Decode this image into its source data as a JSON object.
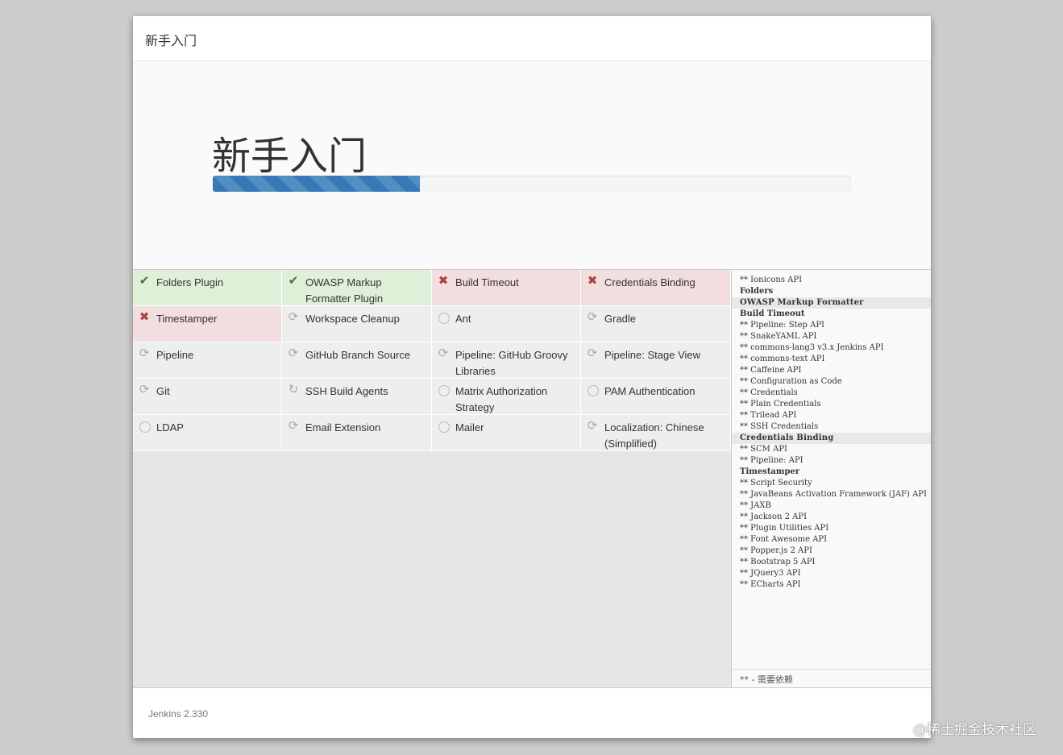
{
  "dialog": {
    "header_title": "新手入门",
    "hero_title": "新手入门",
    "progress_fraction": 0.325
  },
  "plugins": [
    {
      "label": "Folders Plugin",
      "status": "success",
      "icon": "check-icon"
    },
    {
      "label": "OWASP Markup Formatter Plugin",
      "status": "success",
      "icon": "check-icon"
    },
    {
      "label": "Build Timeout",
      "status": "fail",
      "icon": "cross-icon"
    },
    {
      "label": "Credentials Binding",
      "status": "fail",
      "icon": "cross-icon"
    },
    {
      "label": "Timestamper",
      "status": "fail",
      "icon": "cross-icon"
    },
    {
      "label": "Workspace Cleanup",
      "status": "pending",
      "icon": "refresh-icon"
    },
    {
      "label": "Ant",
      "status": "pending",
      "icon": "circle-icon"
    },
    {
      "label": "Gradle",
      "status": "pending",
      "icon": "refresh-icon"
    },
    {
      "label": "Pipeline",
      "status": "pending",
      "icon": "refresh-icon"
    },
    {
      "label": "GitHub Branch Source",
      "status": "pending",
      "icon": "refresh-icon"
    },
    {
      "label": "Pipeline: GitHub Groovy Libraries",
      "status": "pending",
      "icon": "refresh-icon"
    },
    {
      "label": "Pipeline: Stage View",
      "status": "pending",
      "icon": "refresh-icon"
    },
    {
      "label": "Git",
      "status": "pending",
      "icon": "refresh-icon"
    },
    {
      "label": "SSH Build Agents",
      "status": "pending",
      "icon": "sync-icon"
    },
    {
      "label": "Matrix Authorization Strategy",
      "status": "pending",
      "icon": "circle-icon"
    },
    {
      "label": "PAM Authentication",
      "status": "pending",
      "icon": "circle-icon"
    },
    {
      "label": "LDAP",
      "status": "pending",
      "icon": "circle-icon"
    },
    {
      "label": "Email Extension",
      "status": "pending",
      "icon": "refresh-icon"
    },
    {
      "label": "Mailer",
      "status": "pending",
      "icon": "circle-icon"
    },
    {
      "label": "Localization: Chinese (Simplified)",
      "status": "pending",
      "icon": "refresh-icon"
    }
  ],
  "log": {
    "lines": [
      {
        "text": "** Ionicons API",
        "kind": "dep"
      },
      {
        "text": "Folders",
        "kind": "major"
      },
      {
        "text": "OWASP Markup Formatter",
        "kind": "plugin"
      },
      {
        "text": "Build Timeout",
        "kind": "major"
      },
      {
        "text": "** Pipeline: Step API",
        "kind": "dep"
      },
      {
        "text": "** SnakeYAML API",
        "kind": "dep"
      },
      {
        "text": "** commons-lang3 v3.x Jenkins API",
        "kind": "dep"
      },
      {
        "text": "** commons-text API",
        "kind": "dep"
      },
      {
        "text": "** Caffeine API",
        "kind": "dep"
      },
      {
        "text": "** Configuration as Code",
        "kind": "dep"
      },
      {
        "text": "** Credentials",
        "kind": "dep"
      },
      {
        "text": "** Plain Credentials",
        "kind": "dep"
      },
      {
        "text": "** Trilead API",
        "kind": "dep"
      },
      {
        "text": "** SSH Credentials",
        "kind": "dep"
      },
      {
        "text": "Credentials Binding",
        "kind": "plugin"
      },
      {
        "text": "** SCM API",
        "kind": "dep"
      },
      {
        "text": "** Pipeline: API",
        "kind": "dep"
      },
      {
        "text": "Timestamper",
        "kind": "major"
      },
      {
        "text": "** Script Security",
        "kind": "dep"
      },
      {
        "text": "** JavaBeans Activation Framework (JAF) API",
        "kind": "dep"
      },
      {
        "text": "** JAXB",
        "kind": "dep"
      },
      {
        "text": "** Jackson 2 API",
        "kind": "dep"
      },
      {
        "text": "** Plugin Utilities API",
        "kind": "dep"
      },
      {
        "text": "** Font Awesome API",
        "kind": "dep"
      },
      {
        "text": "** Popper.js 2 API",
        "kind": "dep"
      },
      {
        "text": "** Bootstrap 5 API",
        "kind": "dep"
      },
      {
        "text": "** JQuery3 API",
        "kind": "dep"
      },
      {
        "text": "** ECharts API",
        "kind": "dep"
      }
    ],
    "footer": "** - 需要依赖"
  },
  "footer": {
    "version": "Jenkins 2.330"
  },
  "watermark": "@稀土掘金技术社区",
  "colors": {
    "success_bg": "#dff0d8",
    "fail_bg": "#f2dede",
    "pending_bg": "#eeeeee",
    "progress_bar": "#337ab7"
  }
}
